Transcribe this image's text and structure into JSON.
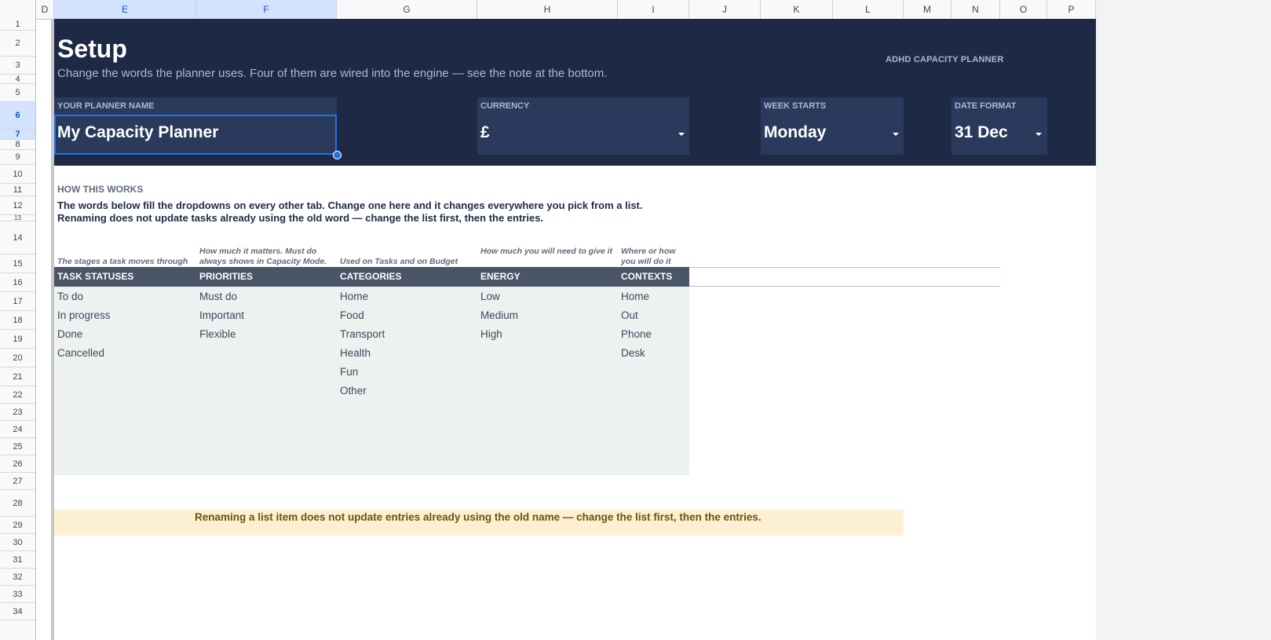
{
  "columns": [
    "D",
    "E",
    "F",
    "G",
    "H",
    "I",
    "J",
    "K",
    "L",
    "M",
    "N",
    "O",
    "P"
  ],
  "rows": [
    "1",
    "2",
    "3",
    "4",
    "5",
    "6",
    "7",
    "8",
    "9",
    "10",
    "11",
    "12",
    "13",
    "14",
    "15",
    "16",
    "17",
    "18",
    "19",
    "20",
    "21",
    "22",
    "23",
    "24",
    "25",
    "26",
    "27",
    "28",
    "29",
    "30",
    "31",
    "32",
    "33",
    "34"
  ],
  "banner": {
    "title": "Setup",
    "subtitle": "Change the words the planner uses. Four of them are wired into the engine — see the note at the bottom.",
    "brand": "ADHD CAPACITY PLANNER"
  },
  "fields": {
    "planner_name": {
      "label": "YOUR PLANNER NAME",
      "value": "My Capacity Planner"
    },
    "currency": {
      "label": "CURRENCY",
      "value": "£"
    },
    "week_starts": {
      "label": "WEEK STARTS",
      "value": "Monday"
    },
    "date_format": {
      "label": "DATE FORMAT",
      "value": "31 Dec"
    }
  },
  "how": {
    "label": "HOW THIS WORKS",
    "line1": "The words below fill the dropdowns on every other tab. Change one here and it changes everywhere you pick from a list.",
    "line2": "Renaming does not update tasks already using the old word — change the list first, then the entries."
  },
  "lists": {
    "task_statuses": {
      "hint": "The stages a task moves through",
      "header": "TASK STATUSES",
      "items": [
        "To do",
        "In progress",
        "Done",
        "Cancelled"
      ]
    },
    "priorities": {
      "hint": "How much it matters. Must do always shows in Capacity Mode.",
      "header": "PRIORITIES",
      "items": [
        "Must do",
        "Important",
        "Flexible"
      ]
    },
    "categories": {
      "hint": "Used on Tasks and on Budget",
      "header": "CATEGORIES",
      "items": [
        "Home",
        "Food",
        "Transport",
        "Health",
        "Fun",
        "Other"
      ]
    },
    "energy": {
      "hint": "How much you will need to give it",
      "header": "ENERGY",
      "items": [
        "Low",
        "Medium",
        "High"
      ]
    },
    "contexts": {
      "hint": "Where or how you will do it",
      "header": "CONTEXTS",
      "items": [
        "Home",
        "Out",
        "Phone",
        "Desk"
      ]
    }
  },
  "note": "Renaming a list item does not update entries already using the old name — change the list first, then the entries.",
  "colors": {
    "banner": "#1e2a45",
    "field_bg": "#2a3a5c",
    "header_row": "#4a5568",
    "list_bg": "#edf1f0",
    "note_bg": "#fdf0d2",
    "selection": "#1a73e8"
  }
}
